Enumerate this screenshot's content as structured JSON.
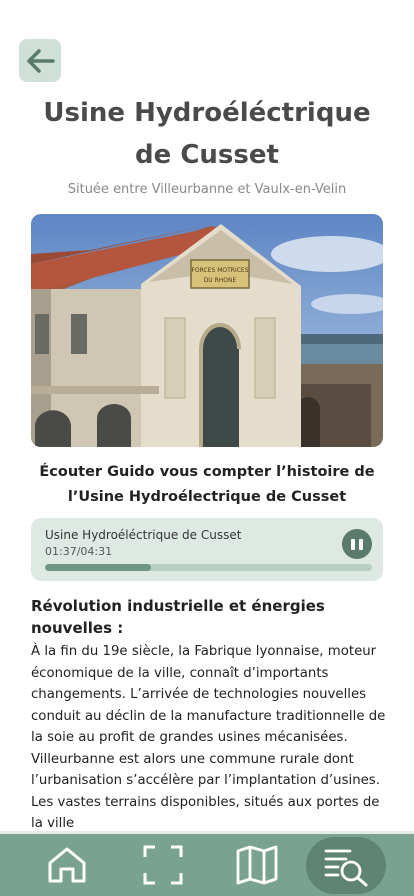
{
  "header": {
    "back_icon": "arrow-left-icon",
    "title": "Usine Hydroéléctrique de Cusset",
    "subtitle": "Située entre Villeurbanne et Vaulx-en-Velin"
  },
  "hero_image": {
    "sign_text": "FORCES MOTRICES DU RHONE"
  },
  "listen_prompt": "Écouter Guido vous compter l’histoire de l’Usine Hydroélectrique de Cusset",
  "player": {
    "track_title": "Usine Hydroéléctrique de Cusset",
    "time": "01:37/04:31",
    "progress": 0.325,
    "button_icon": "pause-icon"
  },
  "article": {
    "section_title": "Révolution industrielle et énergies nouvelles :",
    "body": "À la fin du 19e siècle, la Fabrique lyonnaise, moteur économique de la ville, connaît d’importants changements. L’arrivée de technologies nouvelles conduit au déclin de la manufacture traditionnelle de la soie au profit de grandes usines mécanisées. Villeurbanne est alors une commune rurale dont l’urbanisation s’accélère par l’implantation d’usines. Les vastes terrains disponibles, situés aux portes de la ville"
  },
  "bottom_nav": {
    "items": [
      "home-icon",
      "scan-icon",
      "map-icon",
      "search-list-icon"
    ],
    "active": "search-list-icon"
  },
  "colors": {
    "accent": "#7aa291",
    "accent_dark": "#5a7a6b",
    "player_bg": "#dfe9e4",
    "back_bg": "#cfe0d8"
  }
}
